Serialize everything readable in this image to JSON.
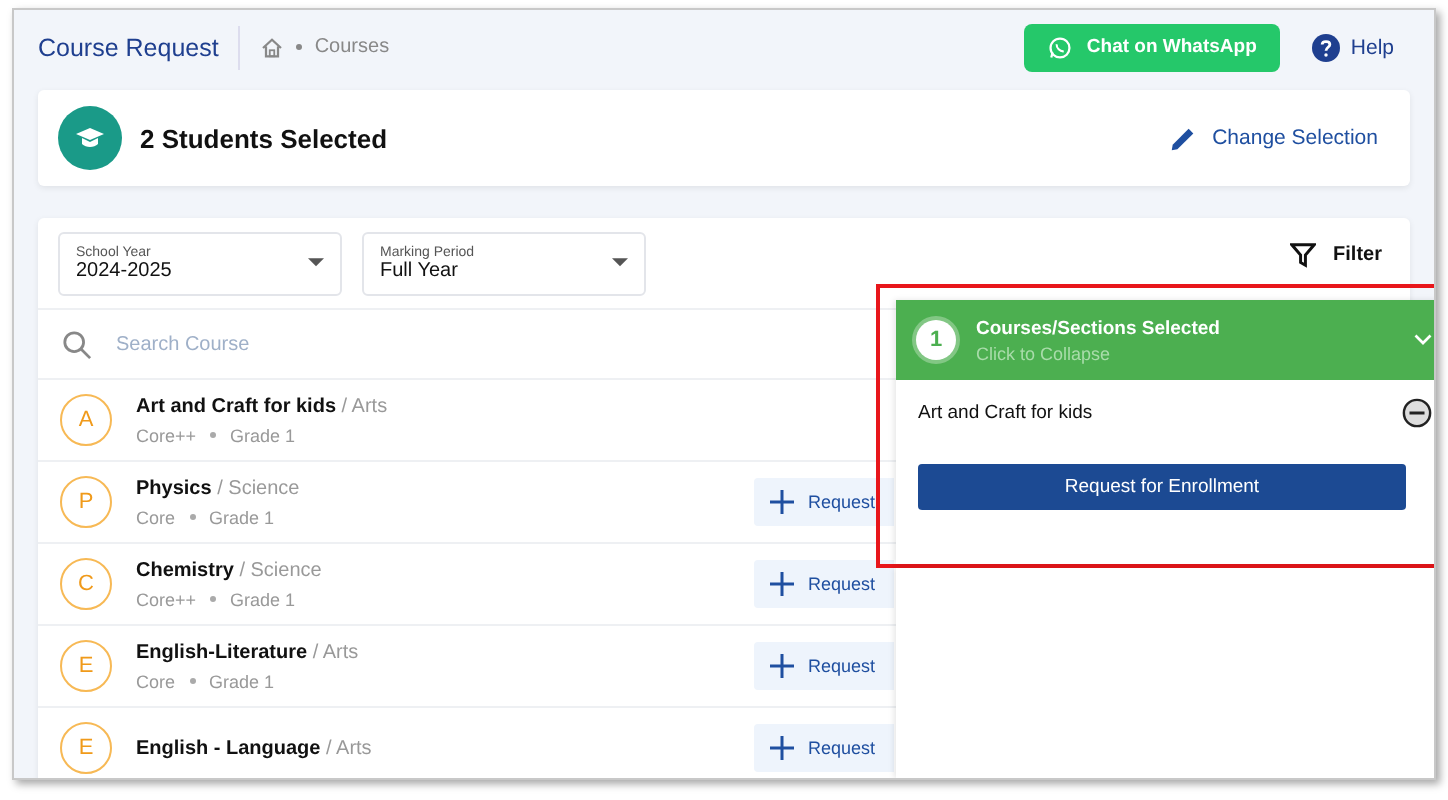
{
  "header": {
    "title": "Course Request",
    "breadcrumb": "Courses",
    "whatsapp_button": "Chat on WhatsApp",
    "help": "Help"
  },
  "students": {
    "label": "2 Students Selected",
    "change_button": "Change Selection"
  },
  "filters": [
    {
      "label": "School Year",
      "value": "2024-2025"
    },
    {
      "label": "Marking Period",
      "value": "Full Year"
    }
  ],
  "filter_button": "Filter",
  "search": {
    "placeholder": "Search Course"
  },
  "courses": [
    {
      "initial": "A",
      "name": "Art and Craft for kids",
      "subject": "/ Arts",
      "level": "Core++",
      "grade": "Grade 1",
      "selected": true
    },
    {
      "initial": "P",
      "name": "Physics",
      "subject": "/ Science",
      "level": "Core",
      "grade": "Grade 1",
      "selected": false,
      "request_button": "Request"
    },
    {
      "initial": "C",
      "name": "Chemistry",
      "subject": "/ Science",
      "level": "Core++",
      "grade": "Grade 1",
      "selected": false,
      "request_button": "Request"
    },
    {
      "initial": "E",
      "name": "English-Literature",
      "subject": "/ Arts",
      "level": "Core",
      "grade": "Grade 1",
      "selected": false,
      "request_button": "Request"
    },
    {
      "initial": "E",
      "name": "English - Language",
      "subject": "/ Arts",
      "selected": false,
      "request_button": "Request"
    }
  ],
  "selection_panel": {
    "count": "1",
    "title": "Courses/Sections Selected",
    "subtitle": "Click to Collapse",
    "items": [
      {
        "name": "Art and Craft for kids"
      }
    ],
    "enroll_button": "Request for Enrollment"
  }
}
